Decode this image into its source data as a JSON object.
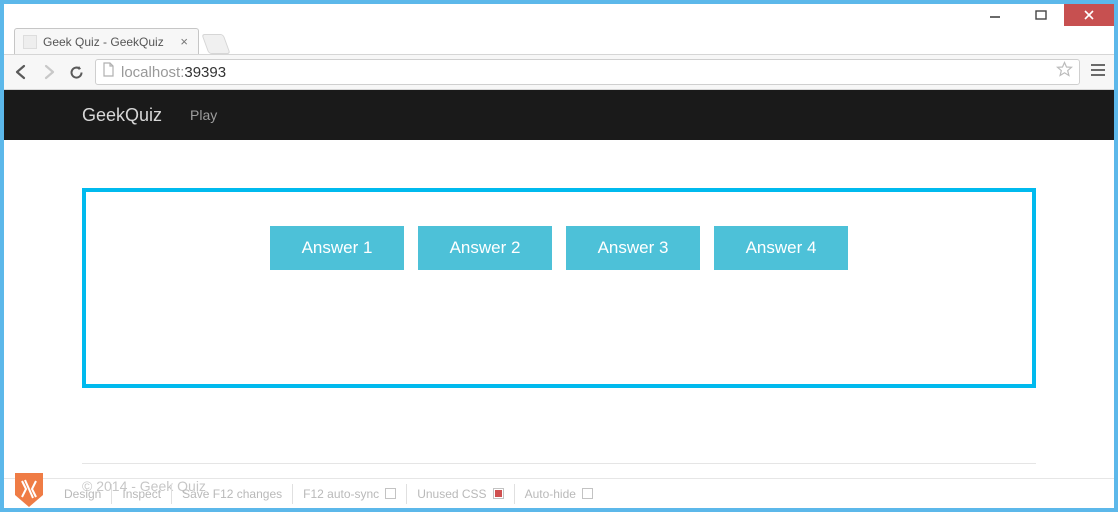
{
  "window": {
    "tab_title": "Geek Quiz - GeekQuiz",
    "url_host": "localhost:",
    "url_port": "39393"
  },
  "navbar": {
    "brand": "GeekQuiz",
    "links": [
      "Play"
    ]
  },
  "quiz": {
    "answers": [
      "Answer 1",
      "Answer 2",
      "Answer 3",
      "Answer 4"
    ]
  },
  "footer": {
    "text": "© 2014 - Geek Quiz"
  },
  "debugbar": {
    "items": [
      {
        "label": "Design"
      },
      {
        "label": "Inspect"
      },
      {
        "label": "Save F12 changes"
      },
      {
        "label": "F12 auto-sync",
        "checkbox": true,
        "checked": false
      },
      {
        "label": "Unused CSS",
        "checkbox": true,
        "checked": true
      },
      {
        "label": "Auto-hide",
        "checkbox": true,
        "checked": false
      }
    ]
  }
}
